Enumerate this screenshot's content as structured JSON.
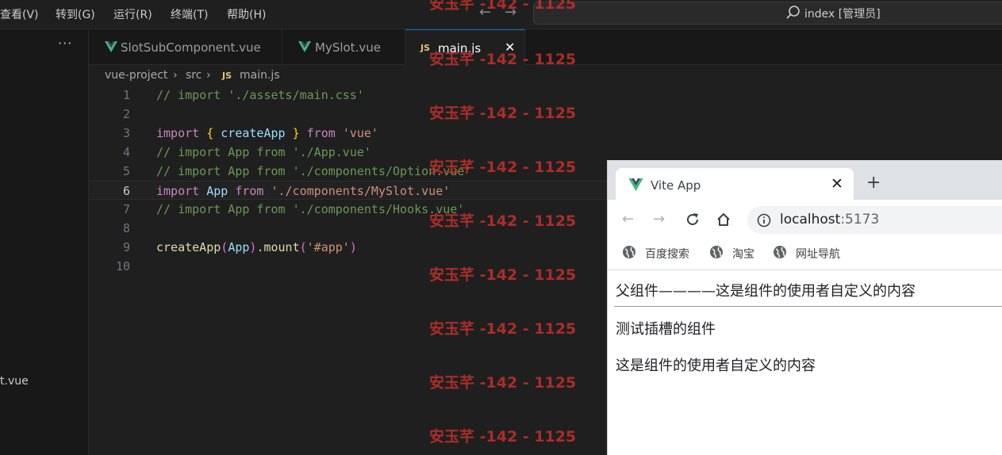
{
  "menu": {
    "view": "查看(V)",
    "goto": "转到(G)",
    "run": "运行(R)",
    "terminal": "终端(T)",
    "help": "帮助(H)"
  },
  "command_center": {
    "text": "index [管理员]"
  },
  "sidebar": {
    "more": "···",
    "file_fragment": "t.vue"
  },
  "tabs": [
    {
      "label": "SlotSubComponent.vue",
      "icon": "vue-icon"
    },
    {
      "label": "MySlot.vue",
      "icon": "vue-icon"
    },
    {
      "label": "main.js",
      "icon": "js-icon",
      "badge": "JS",
      "close": "✕"
    }
  ],
  "breadcrumb": {
    "root": "vue-project",
    "folder": "src",
    "badge": "JS",
    "file": "main.js"
  },
  "code_lines": [
    {
      "num": "1",
      "parts": [
        [
          "c-comment",
          "// import './assets/main.css'"
        ]
      ]
    },
    {
      "num": "2",
      "parts": []
    },
    {
      "num": "3",
      "parts": [
        [
          "c-kw",
          "import"
        ],
        [
          "c-plain",
          " "
        ],
        [
          "c-brace",
          "{"
        ],
        [
          "c-plain",
          " "
        ],
        [
          "c-var",
          "createApp"
        ],
        [
          "c-plain",
          " "
        ],
        [
          "c-brace",
          "}"
        ],
        [
          "c-plain",
          " "
        ],
        [
          "c-kw",
          "from"
        ],
        [
          "c-plain",
          " "
        ],
        [
          "c-str",
          "'vue'"
        ]
      ]
    },
    {
      "num": "4",
      "parts": [
        [
          "c-comment",
          "// import App from './App.vue'"
        ]
      ]
    },
    {
      "num": "5",
      "parts": [
        [
          "c-comment",
          "// import App from './components/Option.vue'"
        ]
      ]
    },
    {
      "num": "6",
      "current": true,
      "parts": [
        [
          "c-kw",
          "import"
        ],
        [
          "c-plain",
          " "
        ],
        [
          "c-var",
          "App"
        ],
        [
          "c-plain",
          " "
        ],
        [
          "c-kw",
          "from"
        ],
        [
          "c-plain",
          " "
        ],
        [
          "c-str",
          "'./components/MySlot.vue'"
        ]
      ]
    },
    {
      "num": "7",
      "parts": [
        [
          "c-comment",
          "// import App from './components/Hooks.vue'"
        ]
      ]
    },
    {
      "num": "8",
      "parts": []
    },
    {
      "num": "9",
      "parts": [
        [
          "c-fn",
          "createApp"
        ],
        [
          "c-paren",
          "("
        ],
        [
          "c-var",
          "App"
        ],
        [
          "c-paren",
          ")"
        ],
        [
          "c-plain",
          "."
        ],
        [
          "c-fn",
          "mount"
        ],
        [
          "c-paren",
          "("
        ],
        [
          "c-str",
          "'#app'"
        ],
        [
          "c-paren",
          ")"
        ]
      ]
    },
    {
      "num": "10",
      "parts": []
    }
  ],
  "browser": {
    "tab_title": "Vite App",
    "tab_close": "✕",
    "new_tab": "+",
    "url_host": "localhost",
    "url_port": ":5173",
    "bookmarks": [
      "百度搜索",
      "淘宝",
      "网址导航"
    ],
    "page": {
      "line1": "父组件————这是组件的使用者自定义的内容",
      "line2": "测试插槽的组件",
      "line3": "这是组件的使用者自定义的内容"
    }
  },
  "watermark": "安玉芊 -142 - 1125"
}
